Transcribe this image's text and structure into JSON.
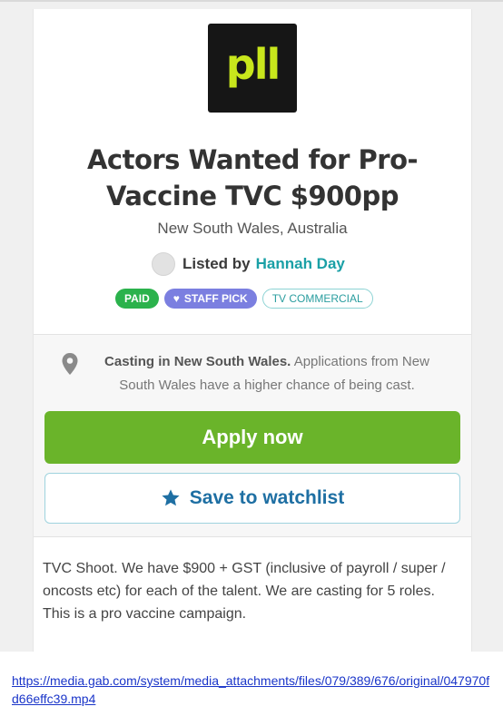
{
  "logo": {
    "text": "pll",
    "color": "#c8e61c",
    "background": "#161616"
  },
  "listing": {
    "title": "Actors Wanted for Pro-Vaccine TVC $900pp",
    "location": "New South Wales, Australia",
    "listed_by_label": "Listed by",
    "listed_by_name": "Hannah Day"
  },
  "badges": {
    "paid": "PAID",
    "staff_pick": "STAFF PICK",
    "tv_commercial": "TV COMMERCIAL"
  },
  "casting_notice": {
    "strong": "Casting in New South Wales.",
    "text": " Applications from New South Wales have a higher chance of being cast."
  },
  "buttons": {
    "apply": "Apply now",
    "watchlist": "Save to watchlist"
  },
  "description": {
    "line1": "TVC Shoot. We have $900 + GST (inclusive of payroll / super / oncosts etc) for each of the talent. We are casting for 5 roles.",
    "line2": "This is a pro vaccine campaign."
  },
  "source_link": "https://media.gab.com/system/media_attachments/files/079/389/676/original/047970fd66effc39.mp4",
  "colors": {
    "apply_button": "#6ab42a",
    "link_teal": "#1aa0a6",
    "paid_badge": "#2bb24c",
    "staff_badge": "#7b7fe0",
    "watchlist_text": "#1e6fa3"
  }
}
